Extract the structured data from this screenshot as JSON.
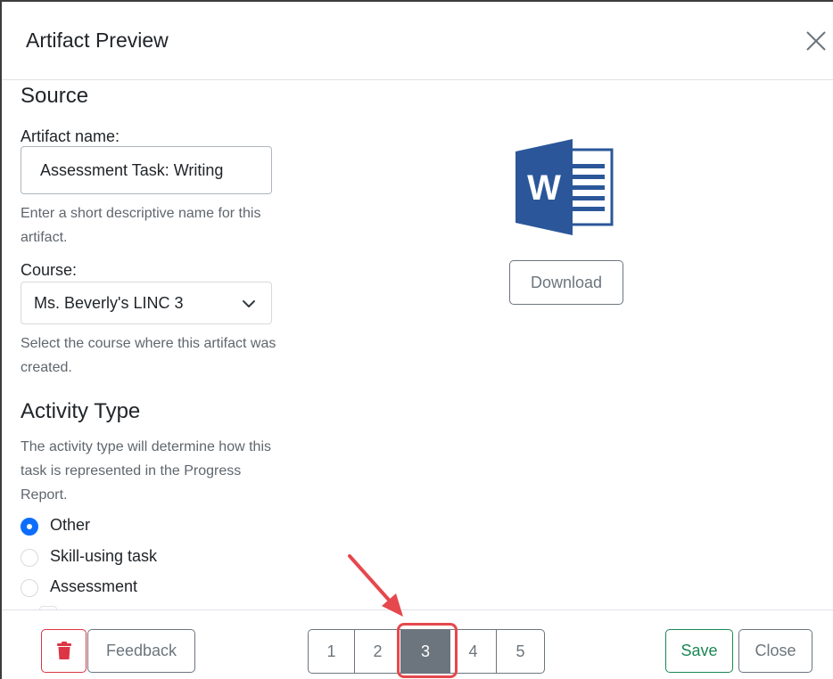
{
  "modal": {
    "title": "Artifact Preview",
    "close_icon": "close-x-icon"
  },
  "source": {
    "heading": "Source",
    "artifact_name_label": "Artifact name:",
    "artifact_name_value": "Assessment Task: Writing",
    "artifact_name_help": "Enter a short descriptive name for this artifact.",
    "course_label": "Course:",
    "course_value": "Ms. Beverly's LINC 3",
    "course_help": "Select the course where this artifact was created."
  },
  "activity": {
    "heading": "Activity Type",
    "help": "The activity type will determine how this task is represented in the Progress Report.",
    "options": [
      {
        "label": "Other",
        "checked": true
      },
      {
        "label": "Skill-using task",
        "checked": false
      },
      {
        "label": "Assessment",
        "checked": false
      }
    ]
  },
  "preview": {
    "file_icon": "word-document-icon",
    "file_letter": "W",
    "download_label": "Download",
    "colors": {
      "word_blue": "#2b579a",
      "word_dark": "#1a4480"
    }
  },
  "footer": {
    "delete_icon": "trash-icon",
    "feedback_label": "Feedback",
    "pages": [
      "1",
      "2",
      "3",
      "4",
      "5"
    ],
    "active_page": "3",
    "save_label": "Save",
    "close_label": "Close"
  },
  "annotation": {
    "arrow_color": "#e5484d",
    "highlight_color": "#e5484d"
  },
  "colors": {
    "primary": "#0d6efd",
    "danger": "#dc3545",
    "success": "#198754",
    "secondary": "#6c757d"
  }
}
